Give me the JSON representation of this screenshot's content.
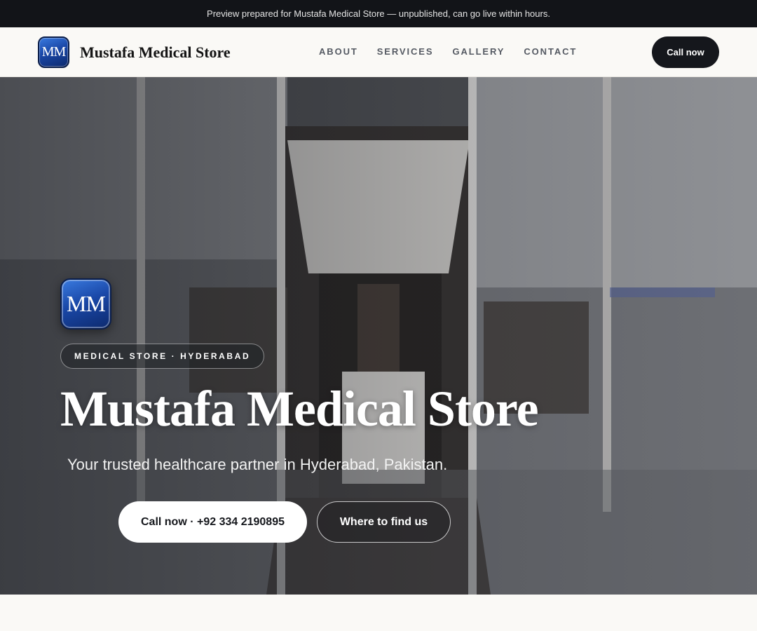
{
  "announcement": "Preview prepared for Mustafa Medical Store — unpublished, can go live within hours.",
  "brand": {
    "logo_text": "MM",
    "name": "Mustafa Medical Store"
  },
  "nav": {
    "items": [
      "ABOUT",
      "SERVICES",
      "GALLERY",
      "CONTACT"
    ],
    "cta": "Call now"
  },
  "hero": {
    "logo_text": "MM",
    "badge": "MEDICAL STORE · HYDERABAD",
    "title": "Mustafa Medical Store",
    "subtitle": "Your trusted healthcare partner in Hyderabad, Pakistan.",
    "primary_button": "Call now · +92 334 2190895",
    "secondary_button": "Where to find us"
  },
  "colors": {
    "topbar": "#121418",
    "dark_button": "#15171c",
    "logo_blue": "#1a48a8"
  }
}
